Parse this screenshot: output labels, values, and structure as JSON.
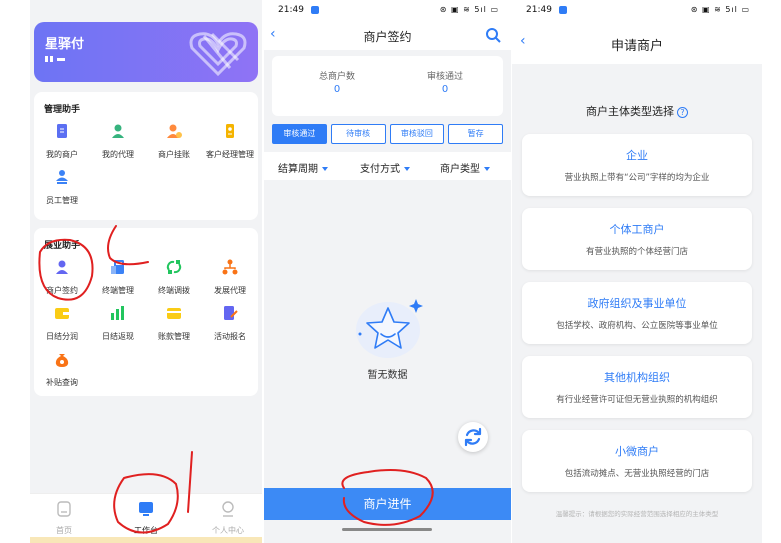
{
  "panel1": {
    "brand": {
      "name": "星驿付"
    },
    "sections": [
      {
        "title": "管理助手",
        "items": [
          {
            "label": "我的商户",
            "icon": "document-icon",
            "color": "#5b6ff2"
          },
          {
            "label": "我的代理",
            "icon": "person-icon",
            "color": "#36b37e"
          },
          {
            "label": "商户挂账",
            "icon": "person-coin-icon",
            "color": "#ff8a3d"
          },
          {
            "label": "客户经理管理",
            "icon": "badge-icon",
            "color": "#f5b400"
          },
          {
            "label": "员工管理",
            "icon": "people-icon",
            "color": "#3b82f6"
          }
        ]
      },
      {
        "title": "展业助手",
        "items": [
          {
            "label": "商户签约",
            "icon": "sign-person-icon",
            "color": "#6366f1"
          },
          {
            "label": "终端管理",
            "icon": "terminal-icon",
            "color": "#3b82f6"
          },
          {
            "label": "终端调拨",
            "icon": "transfer-icon",
            "color": "#22c55e"
          },
          {
            "label": "发展代理",
            "icon": "org-tree-icon",
            "color": "#f97316"
          },
          {
            "label": "日结分润",
            "icon": "wallet-icon",
            "color": "#facc15"
          },
          {
            "label": "日结返现",
            "icon": "bar-chart-icon",
            "color": "#22c55e"
          },
          {
            "label": "账款管理",
            "icon": "card-icon",
            "color": "#facc15"
          },
          {
            "label": "活动报名",
            "icon": "edit-doc-icon",
            "color": "#6366f1"
          },
          {
            "label": "补贴查询",
            "icon": "money-bag-icon",
            "color": "#f97316"
          }
        ]
      }
    ],
    "tabs": [
      {
        "label": "首页",
        "icon": "home-icon"
      },
      {
        "label": "工作台",
        "icon": "workbench-icon",
        "active": true
      },
      {
        "label": "个人中心",
        "icon": "user-icon"
      }
    ]
  },
  "panel2": {
    "status_time": "21:49",
    "status_icons": "⊛ ▣ ≋ 5ıl ▭",
    "title": "商户签约",
    "stats": [
      {
        "label": "总商户数",
        "value": "0"
      },
      {
        "label": "审核通过",
        "value": "0"
      }
    ],
    "status_tabs": [
      "审核通过",
      "待审核",
      "审核驳回",
      "暂存"
    ],
    "filters": [
      "结算周期",
      "支付方式",
      "商户类型"
    ],
    "empty_text": "暂无数据",
    "submit_label": "商户进件"
  },
  "panel3": {
    "status_time": "21:49",
    "status_icons": "⊛ ▣ ≋ 5ıl ▭",
    "title": "申请商户",
    "heading": "商户主体类型选择",
    "help_glyph": "?",
    "types": [
      {
        "title": "企业",
        "desc": "营业执照上带有“公司”字样的均为企业"
      },
      {
        "title": "个体工商户",
        "desc": "有营业执照的个体经营门店"
      },
      {
        "title": "政府组织及事业单位",
        "desc": "包括学校、政府机构、公立医院等事业单位"
      },
      {
        "title": "其他机构组织",
        "desc": "有行业经营许可证但无营业执照的机构组织"
      },
      {
        "title": "小微商户",
        "desc": "包括流动摊点、无营业执照经营的门店"
      }
    ],
    "tip": "温馨提示：请根据您的实际经营范围选择相应的主体类型"
  },
  "colors": {
    "primary": "#2f7cf6",
    "submit": "#3c8af5",
    "annotation": "#e02020",
    "brand_gradient_start": "#6d74f4"
  }
}
